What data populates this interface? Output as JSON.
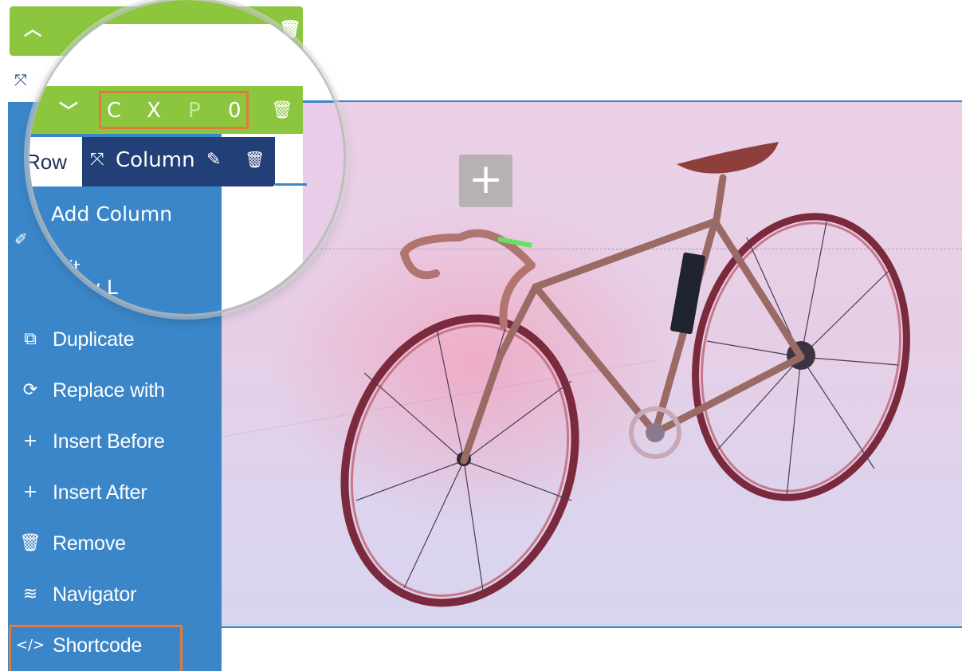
{
  "toolbar": {
    "top_icons": {
      "up": "chevron-up-icon",
      "down": "chevron-down-icon",
      "trash": "trash-icon"
    },
    "zoom_letters": [
      "C",
      "X",
      "P",
      "0"
    ]
  },
  "breadcrumb": {
    "row_label": "Row",
    "column_label": "Column"
  },
  "menu": {
    "add_column": "Add Column",
    "edit_fragment": "lit",
    "row_layout_fragment": "Row L",
    "items": [
      {
        "label": "Duplicate",
        "icon": "duplicate-icon"
      },
      {
        "label": "Replace with",
        "icon": "refresh-icon"
      },
      {
        "label": "Insert Before",
        "icon": "plus-icon"
      },
      {
        "label": "Insert After",
        "icon": "plus-icon"
      },
      {
        "label": "Remove",
        "icon": "trash-icon"
      },
      {
        "label": "Navigator",
        "icon": "layers-icon"
      },
      {
        "label": "Shortcode",
        "icon": "code-icon"
      }
    ]
  },
  "canvas": {
    "add_symbol": "+"
  },
  "colors": {
    "toolbar_green": "#8cc63f",
    "menu_blue": "#3b86c8",
    "column_pill_navy": "#223f78",
    "highlight_orange": "#e07b3f"
  }
}
